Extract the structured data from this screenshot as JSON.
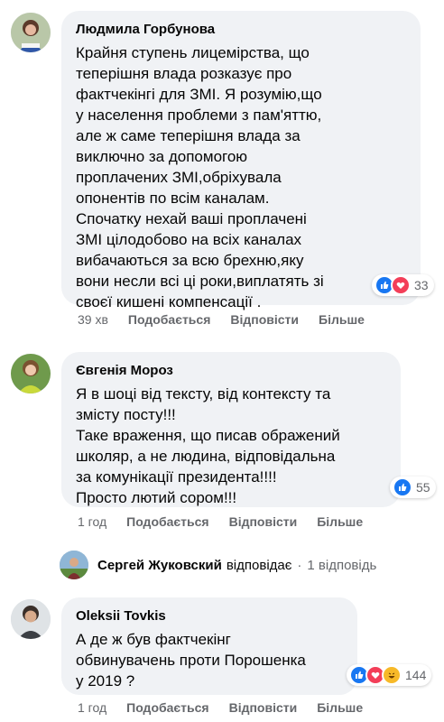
{
  "comments": [
    {
      "author": "Людмила Горбунова",
      "lines": [
        "Крайня ступень лицемірства, що",
        "теперішня влада розказує про",
        "фактчекінгі для ЗМІ. Я розумію,що",
        "у населення проблеми з пам'яттю,",
        "але ж саме теперішня влада за",
        "виключно за допомогою",
        "проплачених ЗМІ,обріхувала",
        "опонентів по всім каналам.",
        "Спочатку нехай ваші проплачені",
        "ЗМІ цілодобово на всіх каналах",
        "вибачаються за всю брехню,яку",
        "вони несли всі ці роки,виплатять зі",
        "своєї кишені компенсації ."
      ],
      "reaction_count": "33",
      "time": "39 хв",
      "like_label": "Подобається",
      "reply_label": "Відповісти",
      "more_label": "Більше"
    },
    {
      "author": "Євгенія Мороз",
      "lines": [
        "Я в шоці від тексту, від контексту та",
        "змісту посту!!!",
        "Таке враження, що писав ображений",
        "школяр, а не людина, відповідальна",
        "за комунікації президента!!!!",
        "Просто лютий сором!!!"
      ],
      "reaction_count": "55",
      "time": "1 год",
      "like_label": "Подобається",
      "reply_label": "Відповісти",
      "more_label": "Більше"
    },
    {
      "author": "Oleksii Tovkis",
      "lines": [
        "А де ж був фактчекінг",
        "обвинувачень проти Порошенка",
        "у 2019 ?"
      ],
      "reaction_count": "144",
      "time": "1 год",
      "like_label": "Подобається",
      "reply_label": "Відповісти",
      "more_label": "Більше"
    }
  ],
  "reply_preview": {
    "author": "Сергей Жуковский",
    "verb": "відповідає",
    "separator": "·",
    "count": "1 відповідь"
  },
  "colors": {
    "bubble": "#f0f2f5",
    "like": "#1877f2",
    "love": "#f33e58",
    "haha": "#f7b928",
    "meta_text": "#65676b"
  }
}
